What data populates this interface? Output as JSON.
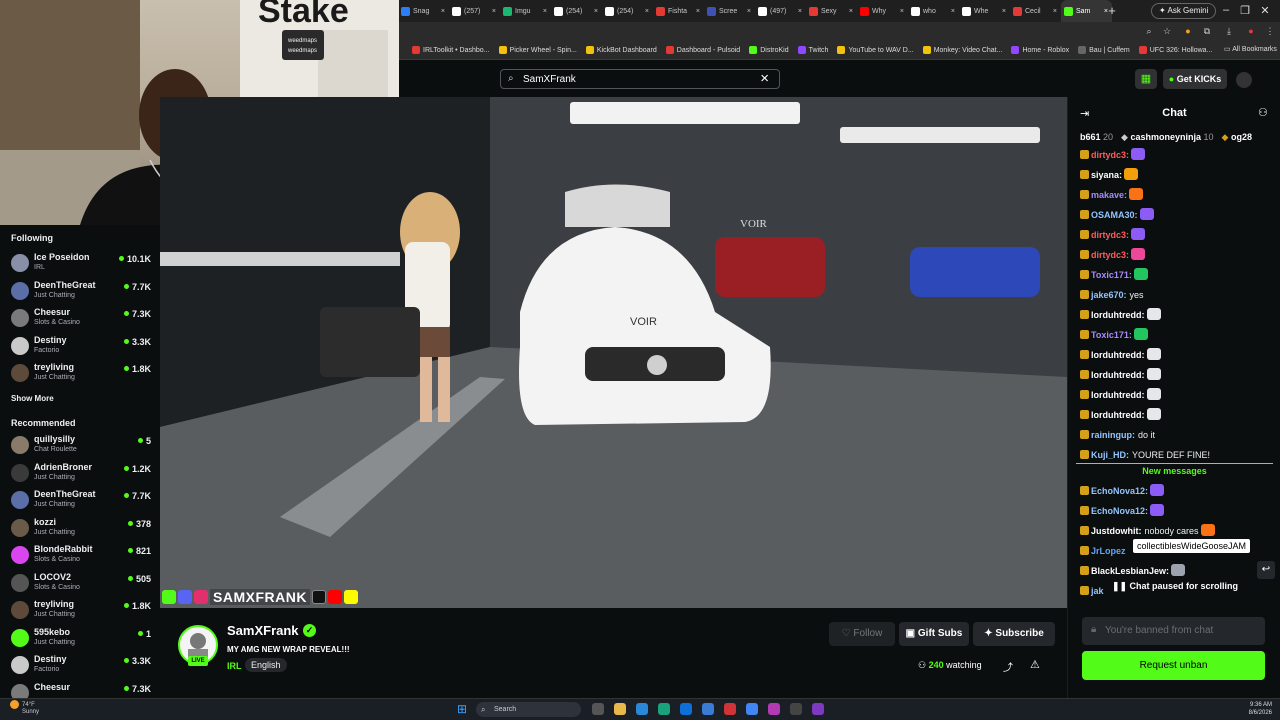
{
  "browser": {
    "tabs": [
      {
        "label": "Snag",
        "color": "#2d7df6"
      },
      {
        "label": "(257)",
        "color": "#ffffff"
      },
      {
        "label": "Imgu",
        "color": "#1bb76e"
      },
      {
        "label": "(254)",
        "color": "#ffffff"
      },
      {
        "label": "(254)",
        "color": "#ffffff"
      },
      {
        "label": "Fishta",
        "color": "#e53935"
      },
      {
        "label": "Scree",
        "color": "#3f51b5"
      },
      {
        "label": "(497)",
        "color": "#ffffff"
      },
      {
        "label": "Sexy",
        "color": "#e53935"
      },
      {
        "label": "Why",
        "color": "#ff0000"
      },
      {
        "label": "who",
        "color": "#ffffff"
      },
      {
        "label": "Whe",
        "color": "#ffffff"
      },
      {
        "label": "Cecil",
        "color": "#e53935"
      },
      {
        "label": "Sam",
        "color": "#53fc18"
      }
    ],
    "new_tab": "+",
    "ask_gemini": "✦ Ask Gemini",
    "window_min": "–",
    "window_max": "❐",
    "window_close": "✕",
    "bookmarks": [
      {
        "label": "IRLToolkit • Dashbo...",
        "color": "#e53935"
      },
      {
        "label": "Picker Wheel - Spin...",
        "color": "#f4c20d"
      },
      {
        "label": "KickBot Dashboard",
        "color": "#f4c20d"
      },
      {
        "label": "Dashboard - Pulsoid",
        "color": "#e53935"
      },
      {
        "label": "DistroKid",
        "color": "#53fc18"
      },
      {
        "label": "Twitch",
        "color": "#9146ff"
      },
      {
        "label": "YouTube to WAV D...",
        "color": "#f4c20d"
      },
      {
        "label": "Monkey: Video Chat...",
        "color": "#f4c20d"
      },
      {
        "label": "Home - Roblox",
        "color": "#9146ff"
      },
      {
        "label": "Bau | Cuffem",
        "color": "#666666"
      },
      {
        "label": "UFC 326: Hollowa...",
        "color": "#e53935"
      }
    ],
    "all_bookmarks": "All Bookmarks"
  },
  "webcam": {
    "sign_text": "Stake",
    "plate_top": "weedmaps",
    "plate_bottom": "weedmaps"
  },
  "sidebar": {
    "following_heading": "Following",
    "following": [
      {
        "name": "Ice Poseidon",
        "category": "IRL",
        "viewers": "10.1K",
        "color": "#8a8fa8"
      },
      {
        "name": "DeenTheGreat",
        "category": "Just Chatting",
        "viewers": "7.7K",
        "color": "#5b6ea8"
      },
      {
        "name": "Cheesur",
        "category": "Slots & Casino",
        "viewers": "7.3K",
        "color": "#7a7a7a"
      },
      {
        "name": "Destiny",
        "category": "Factorio",
        "viewers": "3.3K",
        "color": "#c9c9c9"
      },
      {
        "name": "treyliving",
        "category": "Just Chatting",
        "viewers": "1.8K",
        "color": "#5d4a3a"
      }
    ],
    "show_more": "Show More",
    "recommended_heading": "Recommended",
    "recommended": [
      {
        "name": "quillysilly",
        "category": "Chat Roulette",
        "viewers": "5",
        "color": "#8a7a6a"
      },
      {
        "name": "AdrienBroner",
        "category": "Just Chatting",
        "viewers": "1.2K",
        "color": "#3a3a3a"
      },
      {
        "name": "DeenTheGreat",
        "category": "Just Chatting",
        "viewers": "7.7K",
        "color": "#5b6ea8"
      },
      {
        "name": "kozzi",
        "category": "Just Chatting",
        "viewers": "378",
        "color": "#6a5a4a"
      },
      {
        "name": "BlondeRabbit",
        "category": "Slots & Casino",
        "viewers": "821",
        "color": "#d946ef"
      },
      {
        "name": "LOCOV2",
        "category": "Slots & Casino",
        "viewers": "505",
        "color": "#555555"
      },
      {
        "name": "treyliving",
        "category": "Just Chatting",
        "viewers": "1.8K",
        "color": "#5d4a3a"
      },
      {
        "name": "595kebo",
        "category": "Just Chatting",
        "viewers": "1",
        "color": "#53fc18"
      },
      {
        "name": "Destiny",
        "category": "Factorio",
        "viewers": "3.3K",
        "color": "#c9c9c9"
      },
      {
        "name": "Cheesur",
        "category": "",
        "viewers": "7.3K",
        "color": "#7a7a7a"
      }
    ]
  },
  "header": {
    "search_value": "SamXFrank",
    "search_icon": "search-icon",
    "get_kicks": "Get KICKs"
  },
  "player": {
    "overlay_name": "SAMXFRANK",
    "wall_brand": "VOIR",
    "hood_brand": "VOIR"
  },
  "channel": {
    "name": "SamXFrank",
    "live_badge": "LIVE",
    "title": "MY AMG NEW WRAP REVEAL!!!",
    "category": "IRL",
    "language": "English",
    "follow": "Follow",
    "gift_subs": "Gift Subs",
    "subscribe": "Subscribe",
    "watching_count": "240",
    "watching_label": "watching"
  },
  "chat": {
    "title": "Chat",
    "gifters": [
      {
        "name": "b661",
        "count": "20"
      },
      {
        "name": "cashmoneyninja",
        "count": "10"
      },
      {
        "name": "og28",
        "count": ""
      }
    ],
    "messages": [
      {
        "user": "dirtydc3:",
        "text": "",
        "color": "#ff5c5c",
        "emote": "#8b5cf6"
      },
      {
        "user": "siyana:",
        "text": "",
        "color": "#ffffff",
        "emote": "#f59e0b"
      },
      {
        "user": "makave:",
        "text": "",
        "color": "#a78bfa",
        "emote": "#f97316"
      },
      {
        "user": "OSAMA30:",
        "text": "",
        "color": "#93c5fd",
        "emote": "#8b5cf6"
      },
      {
        "user": "dirtydc3:",
        "text": "",
        "color": "#ff5c5c",
        "emote": "#8b5cf6"
      },
      {
        "user": "dirtydc3:",
        "text": "",
        "color": "#ff5c5c",
        "emote": "#ec4899"
      },
      {
        "user": "Toxic171:",
        "text": "",
        "color": "#a78bfa",
        "emote": "#22c55e"
      },
      {
        "user": "jake670:",
        "text": "yes",
        "color": "#93c5fd",
        "emote": ""
      },
      {
        "user": "lorduhtredd:",
        "text": "",
        "color": "#ffffff",
        "emote": "#e5e7eb"
      },
      {
        "user": "Toxic171:",
        "text": "",
        "color": "#a78bfa",
        "emote": "#22c55e"
      },
      {
        "user": "lorduhtredd:",
        "text": "",
        "color": "#ffffff",
        "emote": "#e5e7eb"
      },
      {
        "user": "lorduhtredd:",
        "text": "",
        "color": "#ffffff",
        "emote": "#e5e7eb"
      },
      {
        "user": "lorduhtredd:",
        "text": "",
        "color": "#ffffff",
        "emote": "#e5e7eb"
      },
      {
        "user": "lorduhtredd:",
        "text": "",
        "color": "#ffffff",
        "emote": "#e5e7eb"
      },
      {
        "user": "rainingup:",
        "text": "do it",
        "color": "#93c5fd",
        "emote": ""
      },
      {
        "user": "Kuji_HD:",
        "text": "YOURE DEF FINE!",
        "color": "#93c5fd",
        "emote": ""
      }
    ],
    "new_messages_label": "New messages",
    "new_messages": [
      {
        "user": "EchoNova12:",
        "text": "",
        "color": "#93c5fd",
        "emote": "#8b5cf6"
      },
      {
        "user": "EchoNova12:",
        "text": "",
        "color": "#93c5fd",
        "emote": "#8b5cf6"
      },
      {
        "user": "Justdowhit:",
        "text": "nobody cares",
        "color": "#ffffff",
        "emote": "#f97316"
      },
      {
        "user": "JrLopez",
        "text": "",
        "color": "#60a5fa",
        "emote": ""
      },
      {
        "user": "BlackLesbianJew:",
        "text": "",
        "color": "#ffffff",
        "emote": "#9ca3af"
      },
      {
        "user": "jak",
        "text": "",
        "color": "#93c5fd",
        "emote": ""
      }
    ],
    "tooltip": "collectiblesWideGooseJAM",
    "paused": "Chat paused for scrolling",
    "input_placeholder": "You're banned from chat",
    "request_unban": "Request unban"
  },
  "taskbar": {
    "weather_temp": "74°F",
    "weather_desc": "Sunny",
    "search": "Search",
    "time": "9:36 AM",
    "date": "8/6/2026"
  }
}
